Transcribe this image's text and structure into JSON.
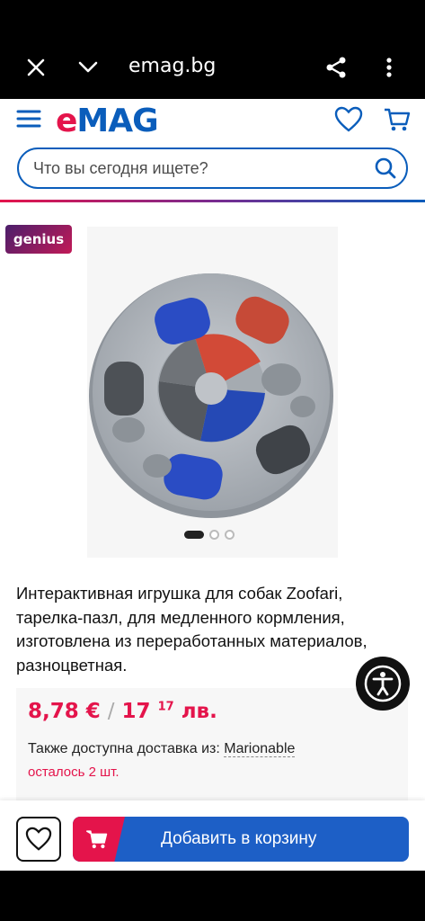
{
  "browser": {
    "url": "emag.bg",
    "icons": [
      "close-icon",
      "chevron-down-icon",
      "share-icon",
      "more-vert-icon"
    ]
  },
  "header": {
    "logo_e": "e",
    "logo_rest": "MAG",
    "search_placeholder": "Что вы сегодня ищете?"
  },
  "badge": {
    "label": "genius"
  },
  "gallery": {
    "total_images": 3,
    "active_index": 0
  },
  "product": {
    "title": "Интерактивная игрушка для собак Zoofari, тарелка-пазл, для медленного кормления, изготовлена из переработанных материалов, разноцветная.",
    "price_eur": "8,78 €",
    "price_sep": "/",
    "price_lev_main": "17",
    "price_lev_decimals": "17",
    "price_lev_unit": "лв.",
    "delivery_prefix": "Также доступна доставка из:",
    "seller": "Marionable",
    "stock": "осталось 2 шт."
  },
  "actions": {
    "add_to_cart": "Добавить в корзину"
  },
  "colors": {
    "brand_red": "#e4144b",
    "brand_blue": "#0a5dbb",
    "button_blue": "#1d5fc6"
  }
}
